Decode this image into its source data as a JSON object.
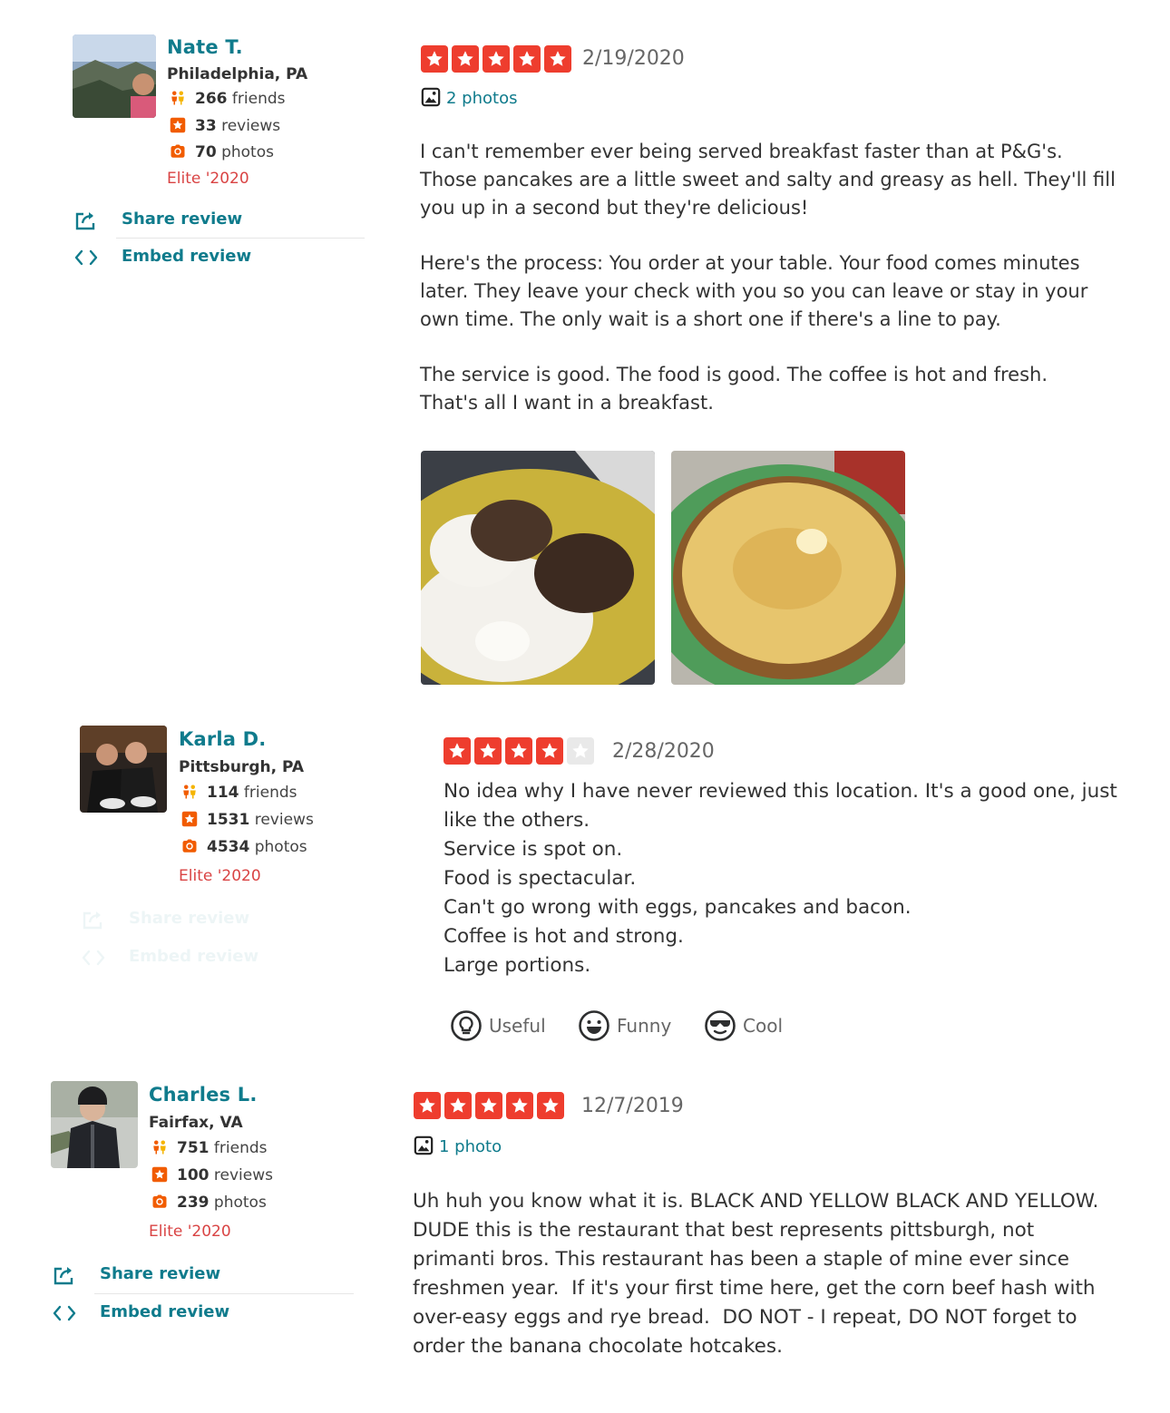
{
  "reviews": [
    {
      "user": {
        "name": "Nate T.",
        "location": "Philadelphia, PA",
        "friends_count": "266",
        "friends_label": "friends",
        "reviews_count": "33",
        "reviews_label": "reviews",
        "photos_count": "70",
        "photos_label": "photos",
        "elite": "Elite '2020"
      },
      "actions": {
        "share": "Share review",
        "embed": "Embed review"
      },
      "rating": 5,
      "date": "2/19/2020",
      "photos_link": "2 photos",
      "paragraphs": [
        "I can't remember ever being served breakfast faster than at P&G's.\nThose pancakes are a little sweet and salty and greasy as hell. They'll fill\nyou up in a second but they're delicious!",
        "Here's the process: You order at your table. Your food comes minutes\nlater. They leave your check with you so you can leave or stay in your\nown time. The only wait is a short one if there's a line to pay.",
        "The service is good. The food is good. The coffee is hot and fresh.\nThat's all I want in a breakfast."
      ]
    },
    {
      "user": {
        "name": "Karla D.",
        "location": "Pittsburgh, PA",
        "friends_count": "114",
        "friends_label": "friends",
        "reviews_count": "1531",
        "reviews_label": "reviews",
        "photos_count": "4534",
        "photos_label": "photos",
        "elite": "Elite '2020"
      },
      "actions": {
        "share": "Share review",
        "embed": "Embed review"
      },
      "rating": 4,
      "date": "2/28/2020",
      "text": "No idea why I have never reviewed this location. It's a good one, just\nlike the others.\nService is spot on.\nFood is spectacular.\nCan't go wrong with eggs, pancakes and bacon.\nCoffee is hot and strong.\nLarge portions.",
      "votes": {
        "useful": "Useful",
        "funny": "Funny",
        "cool": "Cool"
      }
    },
    {
      "user": {
        "name": "Charles L.",
        "location": "Fairfax, VA",
        "friends_count": "751",
        "friends_label": "friends",
        "reviews_count": "100",
        "reviews_label": "reviews",
        "photos_count": "239",
        "photos_label": "photos",
        "elite": "Elite '2020"
      },
      "actions": {
        "share": "Share review",
        "embed": "Embed review"
      },
      "rating": 5,
      "date": "12/7/2019",
      "photos_link": "1 photo",
      "text": "Uh huh you know what it is. BLACK AND YELLOW BLACK AND YELLOW.\nDUDE this is the restaurant that best represents pittsburgh, not\nprimanti bros. This restaurant has been a staple of mine ever since\nfreshmen year.  If it's your first time here, get the corn beef hash with\nover-easy eggs and rye bread.  DO NOT - I repeat, DO NOT forget to\norder the banana chocolate hotcakes."
    }
  ],
  "colors": {
    "accent": "#0f7b8c",
    "star_red": "#ee3d2e",
    "elite_red": "#d32323",
    "star_empty": "#e9e9e9"
  },
  "icons": [
    "friends-icon",
    "review-star-icon",
    "camera-icon",
    "share-icon",
    "embed-icon",
    "photo-icon",
    "useful-icon",
    "funny-icon",
    "cool-icon",
    "star-icon"
  ]
}
